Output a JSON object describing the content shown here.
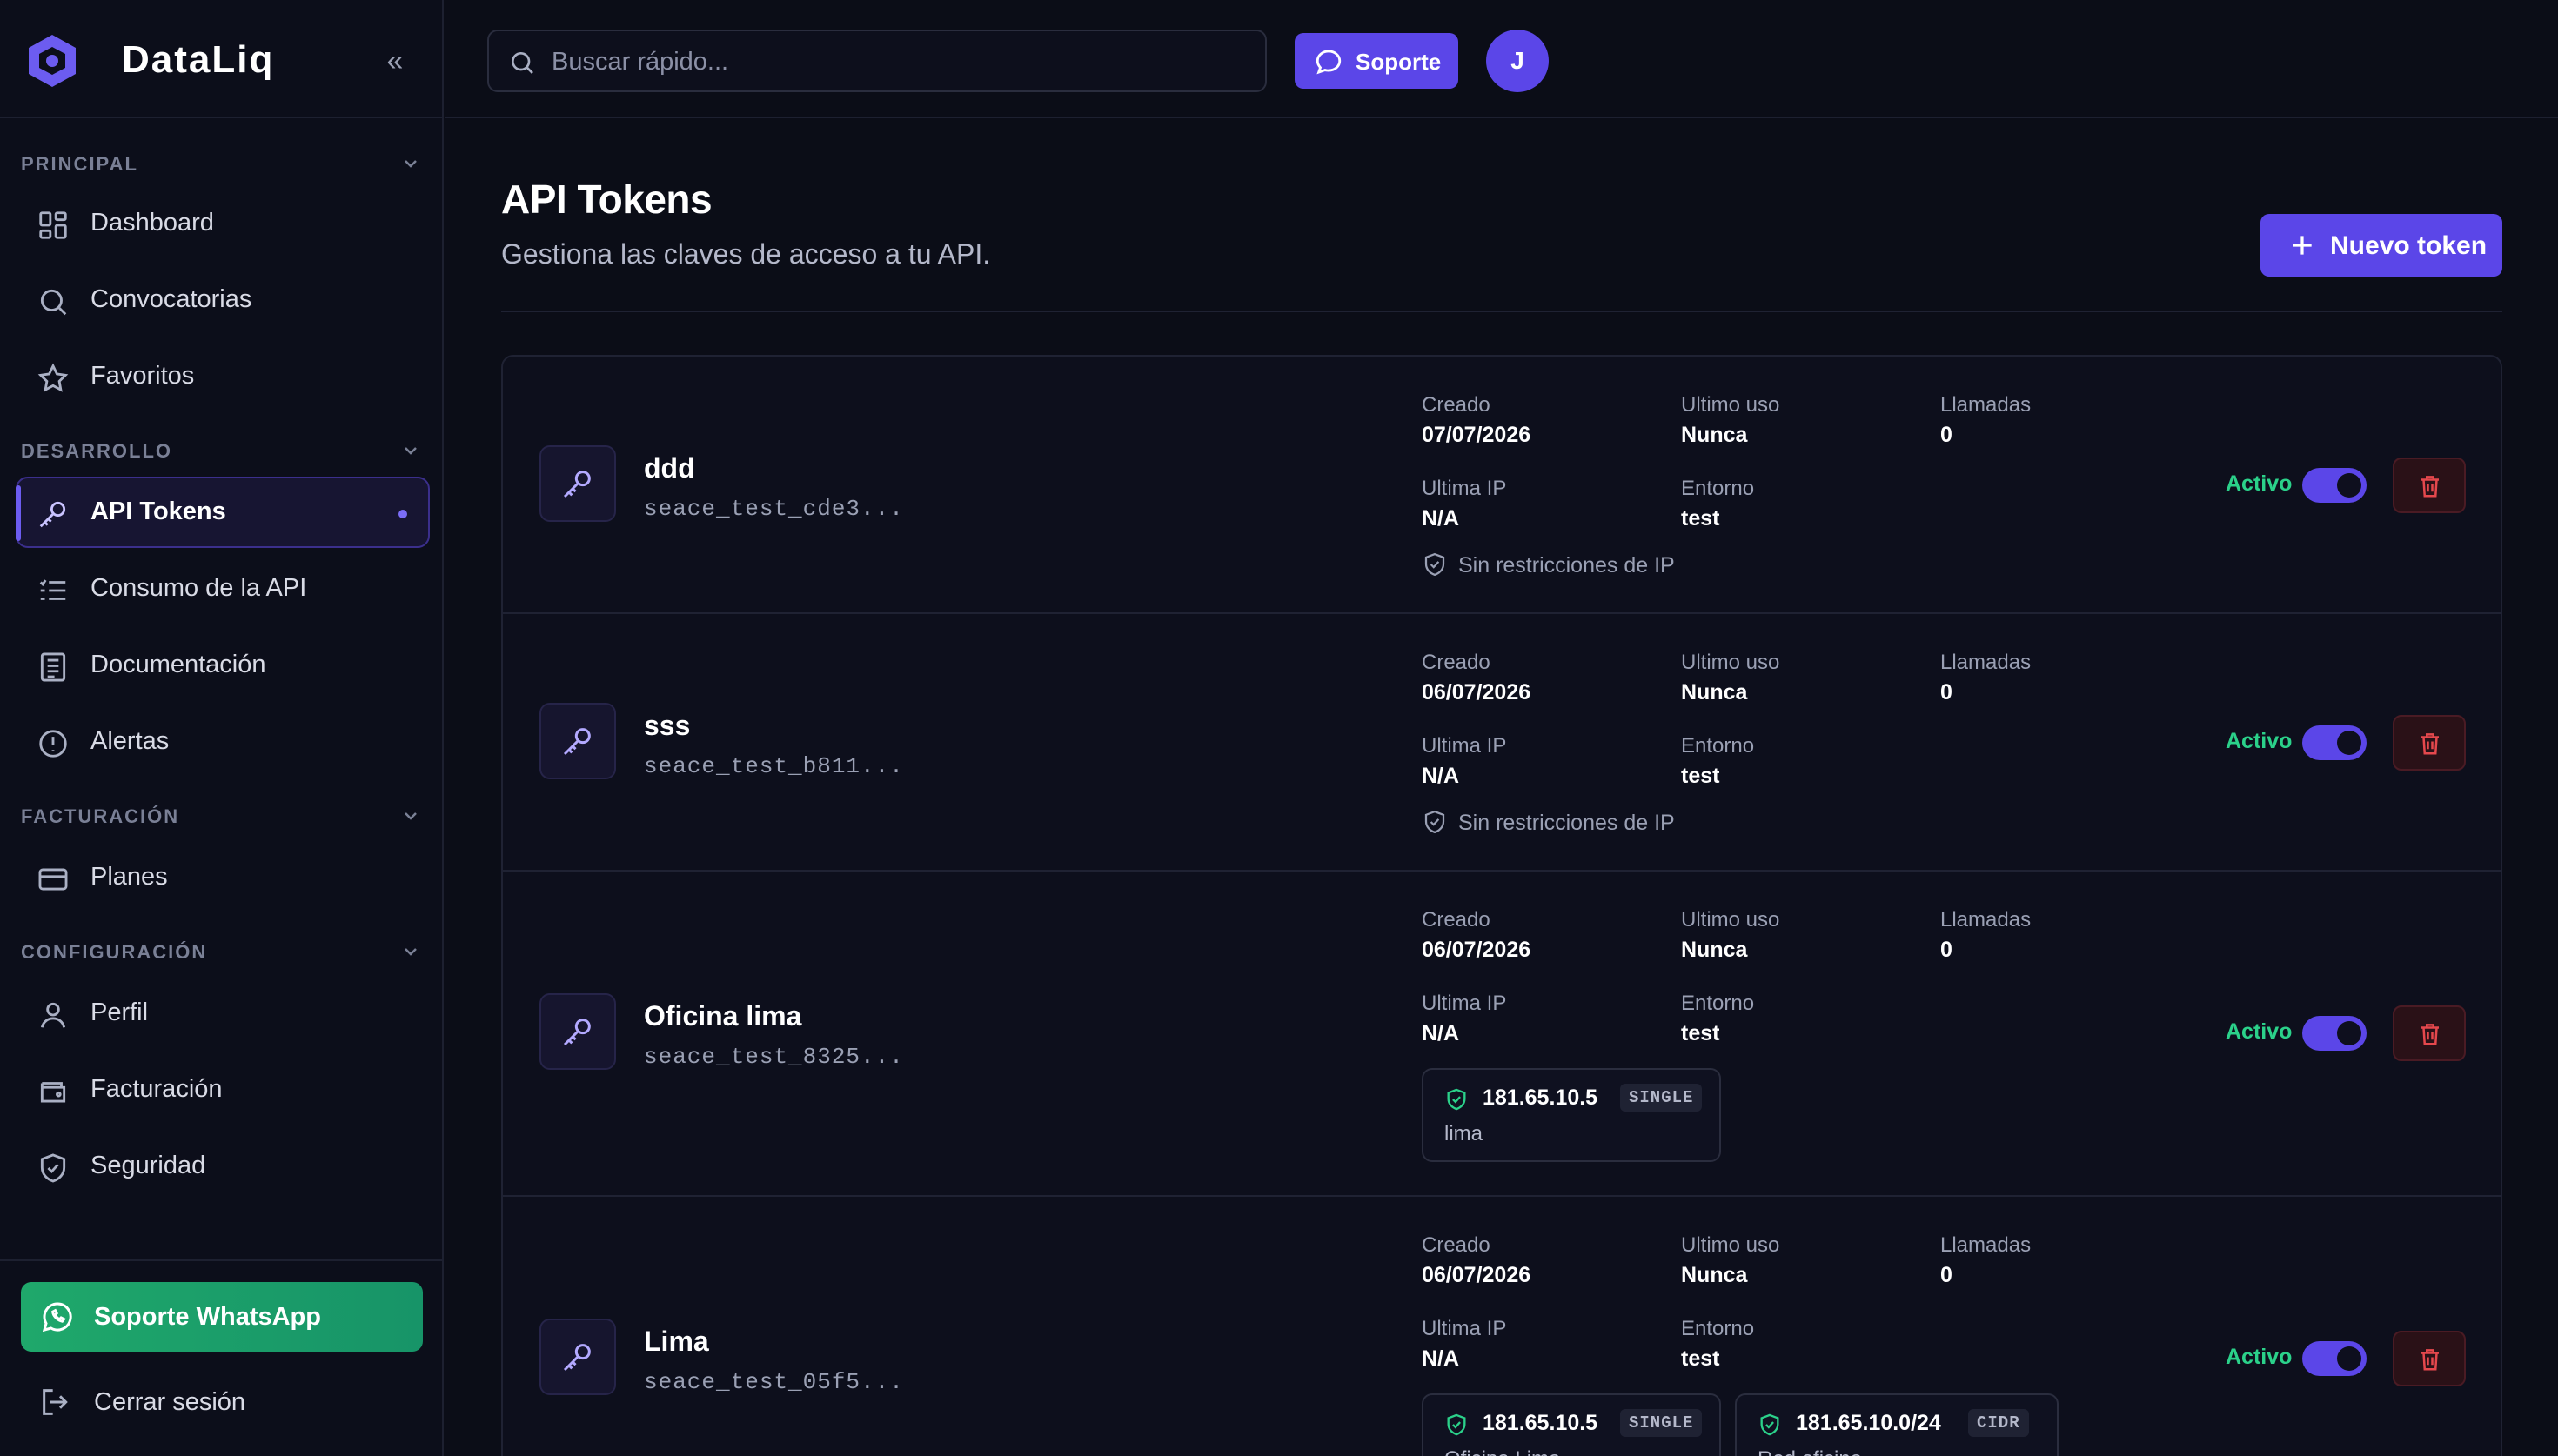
{
  "brand": {
    "name": "DataLiq"
  },
  "search": {
    "placeholder": "Buscar rápido..."
  },
  "topbar": {
    "support_label": "Soporte",
    "avatar_initial": "J"
  },
  "sidebar": {
    "sections": [
      {
        "label": "PRINCIPAL",
        "items": [
          {
            "label": "Dashboard",
            "icon": "grid-icon"
          },
          {
            "label": "Convocatorias",
            "icon": "search-icon"
          },
          {
            "label": "Favoritos",
            "icon": "star-icon"
          }
        ]
      },
      {
        "label": "DESARROLLO",
        "items": [
          {
            "label": "API Tokens",
            "icon": "key-icon",
            "active": true
          },
          {
            "label": "Consumo de la API",
            "icon": "list-icon"
          },
          {
            "label": "Documentación",
            "icon": "document-icon"
          },
          {
            "label": "Alertas",
            "icon": "alert-icon"
          }
        ]
      },
      {
        "label": "FACTURACIÓN",
        "items": [
          {
            "label": "Planes",
            "icon": "card-icon"
          }
        ]
      },
      {
        "label": "CONFIGURACIÓN",
        "items": [
          {
            "label": "Perfil",
            "icon": "user-icon"
          },
          {
            "label": "Facturación",
            "icon": "wallet-icon"
          },
          {
            "label": "Seguridad",
            "icon": "shield-icon"
          }
        ]
      }
    ],
    "whatsapp_label": "Soporte WhatsApp",
    "logout_label": "Cerrar sesión"
  },
  "page": {
    "title": "API Tokens",
    "subtitle": "Gestiona las claves de acceso a tu API.",
    "new_token_label": "Nuevo token"
  },
  "labels": {
    "created": "Creado",
    "last_use": "Ultimo uso",
    "calls": "Llamadas",
    "last_ip": "Ultima IP",
    "environment": "Entorno",
    "no_ip_restrictions": "Sin restricciones de IP"
  },
  "tokens": [
    {
      "name": "ddd",
      "key": "seace_test_cde3...",
      "created": "07/07/2026",
      "last_use": "Nunca",
      "calls": "0",
      "last_ip": "N/A",
      "environment": "test",
      "status": "Activo",
      "ips": []
    },
    {
      "name": "sss",
      "key": "seace_test_b811...",
      "created": "06/07/2026",
      "last_use": "Nunca",
      "calls": "0",
      "last_ip": "N/A",
      "environment": "test",
      "status": "Activo",
      "ips": []
    },
    {
      "name": "Oficina lima",
      "key": "seace_test_8325...",
      "created": "06/07/2026",
      "last_use": "Nunca",
      "calls": "0",
      "last_ip": "N/A",
      "environment": "test",
      "status": "Activo",
      "ips": [
        {
          "ip": "181.65.10.5",
          "type": "SINGLE",
          "desc": "lima"
        }
      ]
    },
    {
      "name": "Lima",
      "key": "seace_test_05f5...",
      "created": "06/07/2026",
      "last_use": "Nunca",
      "calls": "0",
      "last_ip": "N/A",
      "environment": "test",
      "status": "Activo",
      "ips": [
        {
          "ip": "181.65.10.5",
          "type": "SINGLE",
          "desc": "Oficina Lima"
        },
        {
          "ip": "181.65.10.0/24",
          "type": "CIDR",
          "desc": "Red oficina"
        }
      ]
    }
  ],
  "colors": {
    "accent": "#5b46e8",
    "active": "#2bd18a",
    "danger": "#e5484d",
    "background": "#0b0d17"
  }
}
